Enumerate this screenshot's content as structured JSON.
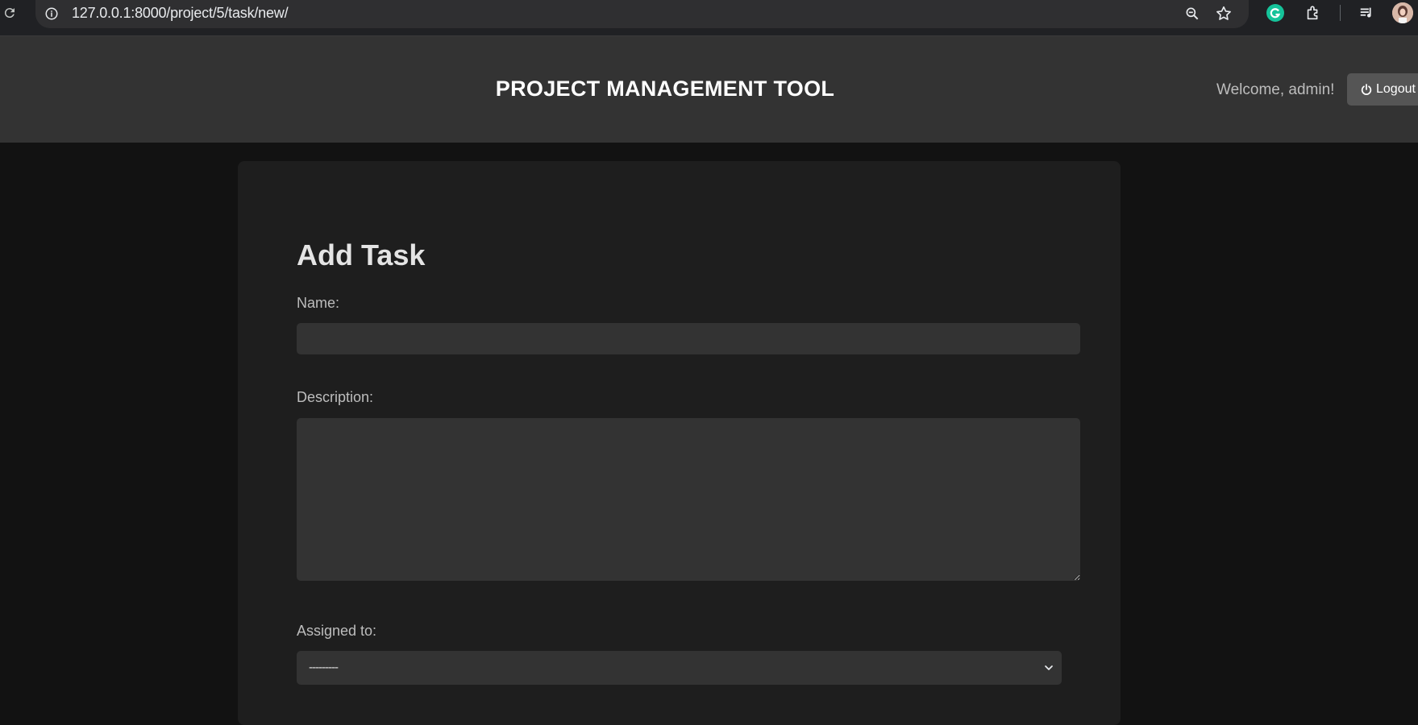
{
  "browser": {
    "url": "127.0.0.1:8000/project/5/task/new/"
  },
  "header": {
    "title": "PROJECT MANAGEMENT TOOL",
    "welcome": "Welcome, admin!",
    "logout_label": "Logout"
  },
  "form": {
    "title": "Add Task",
    "name_label": "Name:",
    "name_value": "",
    "description_label": "Description:",
    "description_value": "",
    "assigned_label": "Assigned to:",
    "assigned_value": "---------"
  },
  "colors": {
    "page_bg": "#121212",
    "header_bg": "#333333",
    "card_bg": "#1e1e1e",
    "input_bg": "#333333",
    "button_bg": "#555555"
  }
}
